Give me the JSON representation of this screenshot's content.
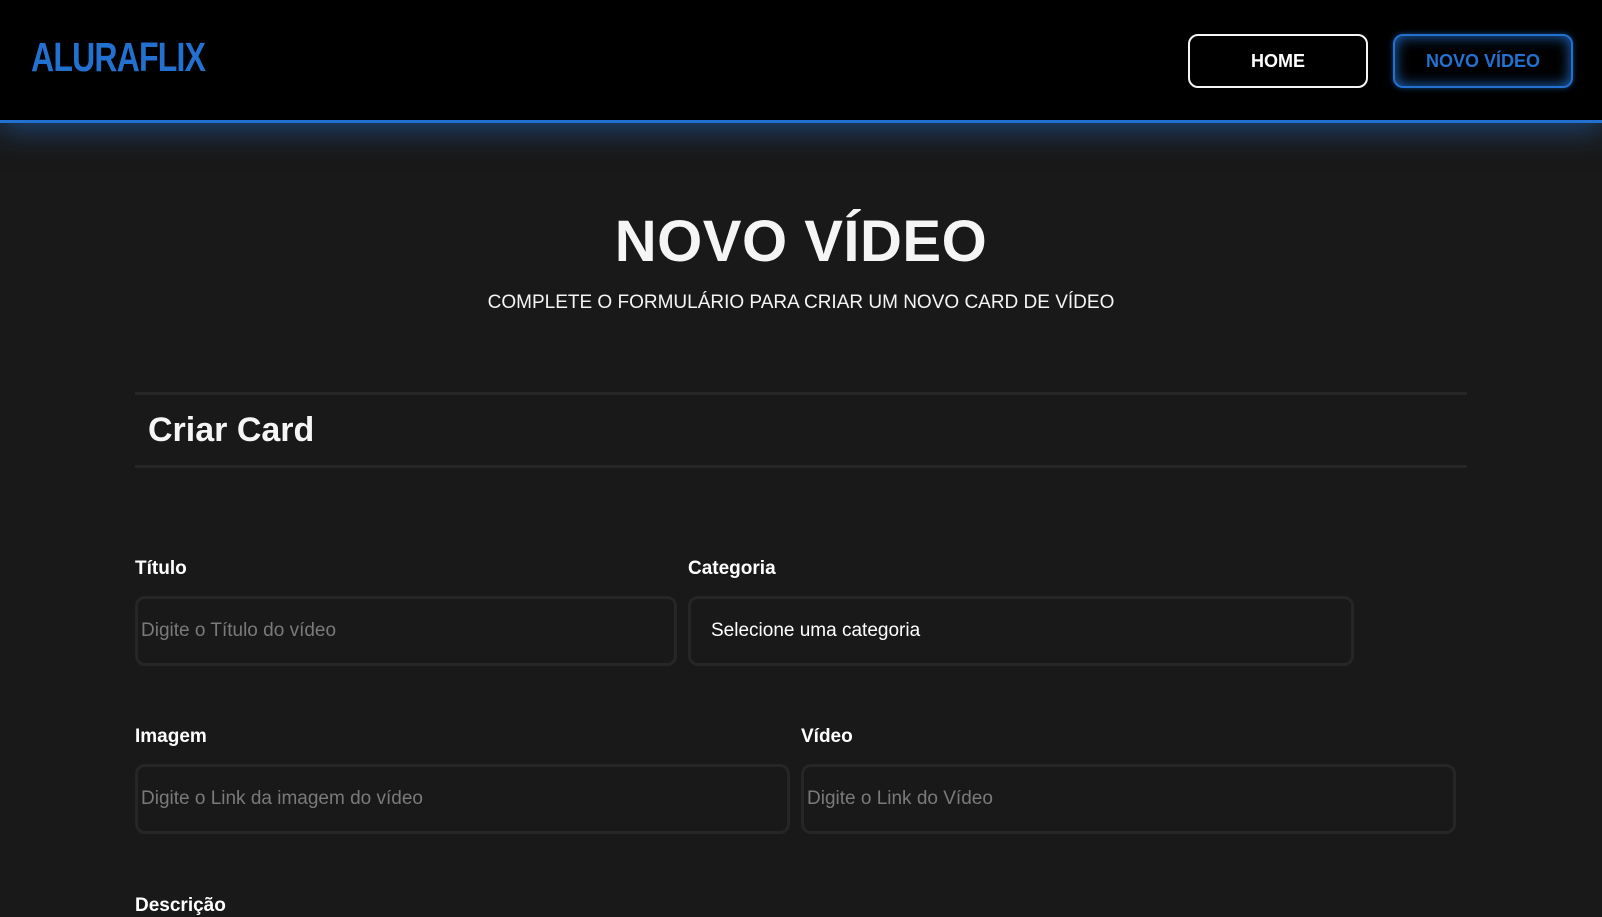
{
  "header": {
    "logo": "ALURAFLIX",
    "nav": {
      "home_label": "HOME",
      "new_video_label": "NOVO VÍDEO"
    }
  },
  "page": {
    "title": "NOVO VÍDEO",
    "subtitle": "COMPLETE O FORMULÁRIO PARA CRIAR UM NOVO CARD DE VÍDEO"
  },
  "form": {
    "section_title": "Criar Card",
    "title_field": {
      "label": "Título",
      "placeholder": "Digite o Título do vídeo",
      "value": ""
    },
    "category_field": {
      "label": "Categoria",
      "selected": "Selecione uma categoria"
    },
    "image_field": {
      "label": "Imagem",
      "placeholder": "Digite o Link da imagem do vídeo",
      "value": ""
    },
    "video_field": {
      "label": "Vídeo",
      "placeholder": "Digite o Link do Vídeo",
      "value": ""
    },
    "description_field": {
      "label": "Descrição"
    }
  },
  "colors": {
    "accent": "#2271d1",
    "header_bg": "#000000",
    "page_bg": "#191919",
    "field_border": "#262626"
  }
}
